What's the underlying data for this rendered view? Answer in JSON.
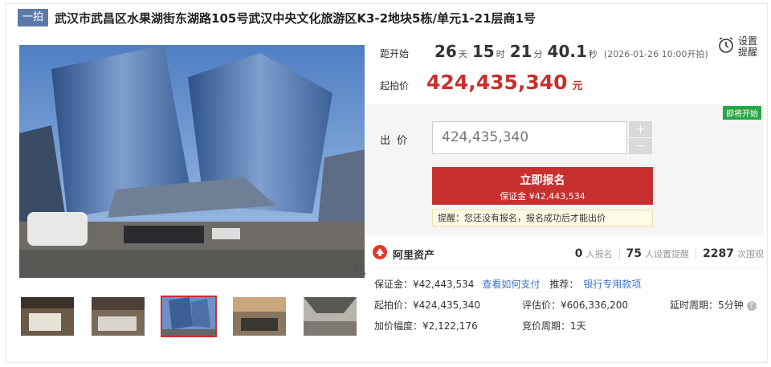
{
  "title": {
    "tag": "一拍",
    "text": "武汉市武昌区水果湖街东湖路105号武汉中央文化旅游区K3-2地块5栋/单元1-21层商1号"
  },
  "countdown": {
    "label": "距开始",
    "days": "26",
    "days_unit": "天",
    "hours": "15",
    "hours_unit": "时",
    "minutes": "21",
    "minutes_unit": "分",
    "seconds": "40.1",
    "seconds_unit": "秒",
    "start_time": "(2026-01-26 10:00开拍)"
  },
  "remind": {
    "line1": "设置",
    "line2": "提醒",
    "icon": "alarm-clock-icon"
  },
  "start_price": {
    "label": "起拍价",
    "value": "424,435,340",
    "unit": "元"
  },
  "status_badge": "即将开始",
  "bid": {
    "label": "出价",
    "value": "424,435,340",
    "plus": "+",
    "minus": "−",
    "apply_label": "立即报名",
    "apply_deposit": "保证金 ¥42,443,534",
    "tip": "提醒：您还没有报名，报名成功后才能出价"
  },
  "platform": {
    "name": "阿里资产",
    "stats": [
      {
        "num": "0",
        "label": "人报名"
      },
      {
        "num": "75",
        "label": "人设置提醒"
      },
      {
        "num": "2287",
        "label": "次围观"
      }
    ]
  },
  "deposit_row": {
    "text": "保证金：¥42,443,534",
    "link": "查看如何支付",
    "recommend": "推荐：",
    "bank_link": "银行专用款项"
  },
  "details": {
    "start_price": "起拍价：¥424,435,340",
    "appraisal": "评估价：¥606,336,200",
    "delay": "延时周期：5分钟",
    "increment": "加价幅度：¥2,122,176",
    "cycle": "竞价周期：1天"
  },
  "colors": {
    "accent": "#c8302f",
    "tag": "#5c7aa8",
    "link": "#3b73c8",
    "badge": "#27a745"
  }
}
